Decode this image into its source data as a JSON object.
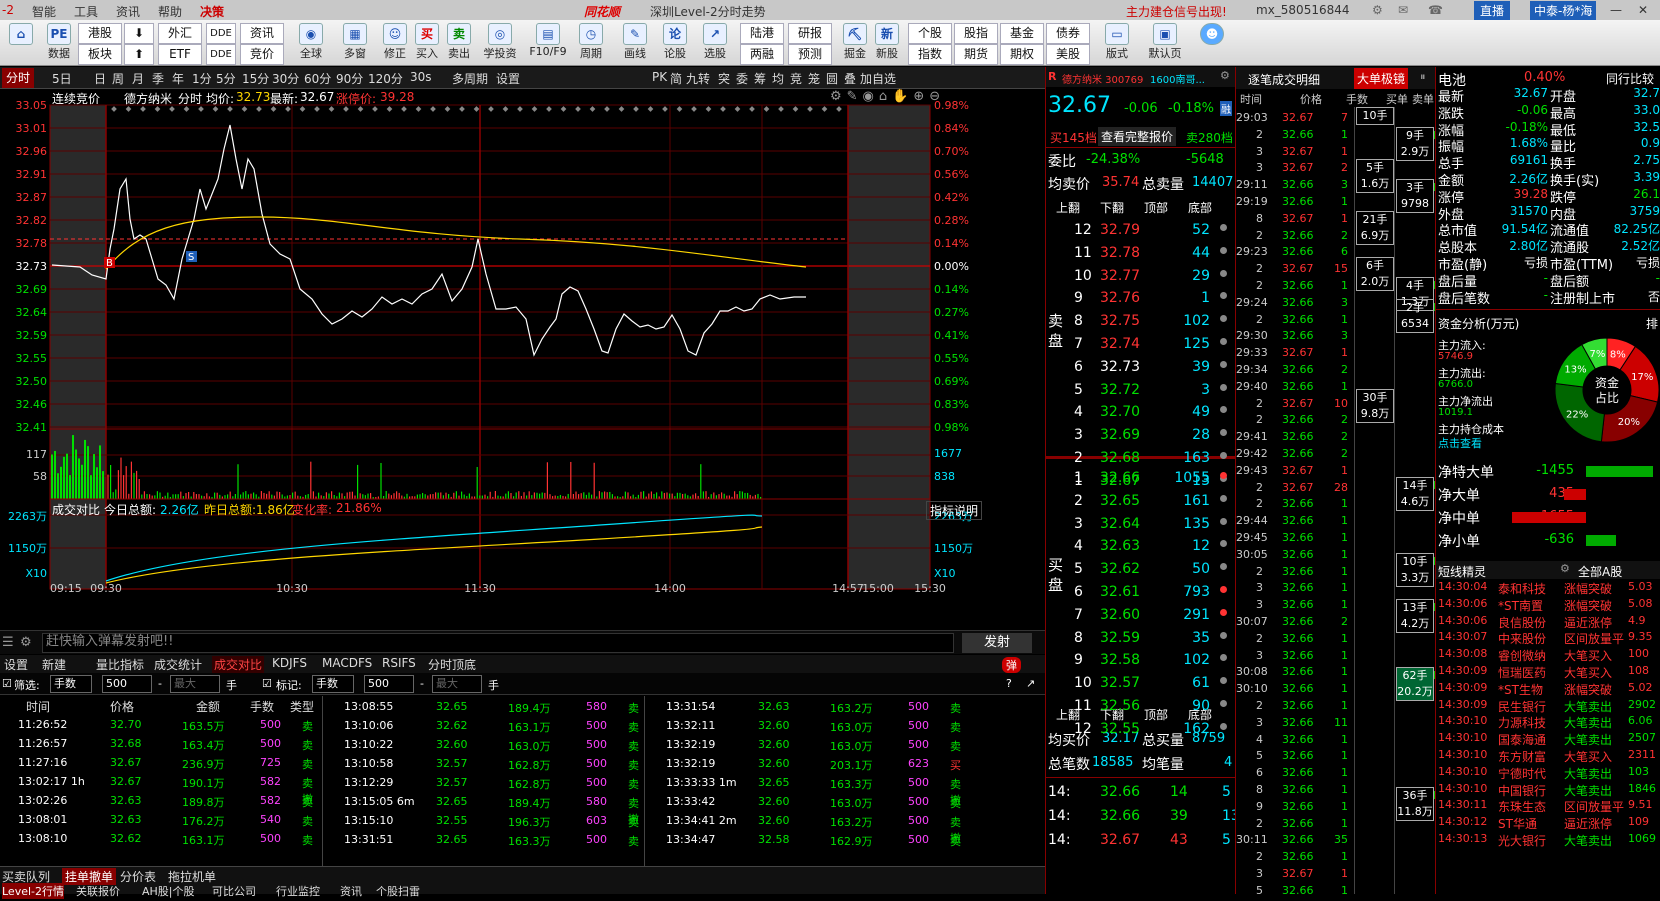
{
  "menu": {
    "left_items": [
      "-2",
      "智能",
      "工具",
      "资讯",
      "帮助",
      "决策"
    ],
    "brand": "同花顺",
    "title": "深圳Level-2分时走势",
    "alert": "主力建仓信号出现!",
    "user": "mx_580516844",
    "live": "直播",
    "broker": "中泰-杨*海"
  },
  "toolbar": {
    "big": [
      {
        "label": "数据",
        "icon": "PE"
      },
      {
        "label": "全球",
        "icon": "◉"
      },
      {
        "label": "多窗",
        "icon": "▦"
      },
      {
        "label": "修正",
        "icon": "☺"
      },
      {
        "label": "买入",
        "icon": "买"
      },
      {
        "label": "卖出",
        "icon": "卖"
      },
      {
        "label": "学投资",
        "icon": "◎"
      },
      {
        "label": "F10/F9",
        "icon": "▤"
      },
      {
        "label": "周期",
        "icon": "◷"
      },
      {
        "label": "画线",
        "icon": "✎"
      },
      {
        "label": "论股",
        "icon": "论"
      },
      {
        "label": "选股",
        "icon": "↗"
      },
      {
        "label": "掘金",
        "icon": "⛏"
      },
      {
        "label": "新股",
        "icon": "新"
      },
      {
        "label": "版式",
        "icon": "▭"
      },
      {
        "label": "默认页",
        "icon": "▣"
      }
    ],
    "small": [
      [
        "港股",
        "板块"
      ],
      [
        "",
        ""
      ],
      [
        "外汇",
        "ETF"
      ],
      [
        "DDE",
        "DDE"
      ],
      [
        "资讯",
        "竞价"
      ],
      [
        "陆港",
        "两融"
      ],
      [
        "研报",
        "预测"
      ],
      [
        "个股",
        "指数"
      ],
      [
        "股指",
        "期货"
      ],
      [
        "基金",
        "期权"
      ],
      [
        "债券",
        "美股"
      ]
    ]
  },
  "period_tabs": [
    "分时",
    "5日",
    "日",
    "周",
    "月",
    "季",
    "年",
    "1分",
    "5分",
    "15分",
    "30分",
    "60分",
    "90分",
    "120分",
    "30s",
    "多周期",
    "设置"
  ],
  "right_tabs": [
    "PK",
    "简",
    "九转",
    "突",
    "委",
    "筹",
    "均",
    "竞",
    "笼",
    "圆",
    "叠",
    "加自选"
  ],
  "chart_header": {
    "label": "连续竞价",
    "name": "德方纳米",
    "mode": "分时",
    "avg_label": "均价:",
    "avg": "32.73",
    "last_label": "最新:",
    "last": "32.67",
    "limit_label": "涨停价:",
    "limit": "39.28"
  },
  "price_axis": [
    "33.05",
    "33.01",
    "32.96",
    "32.91",
    "32.87",
    "32.82",
    "32.78",
    "32.73",
    "32.69",
    "32.64",
    "32.59",
    "32.55",
    "32.50",
    "32.46",
    "32.41"
  ],
  "pct_axis": [
    "0.98%",
    "0.84%",
    "0.70%",
    "0.56%",
    "0.42%",
    "0.28%",
    "0.14%",
    "0.00%",
    "0.14%",
    "0.27%",
    "0.41%",
    "0.55%",
    "0.69%",
    "0.83%",
    "0.98%"
  ],
  "vol_axis": [
    "117",
    "58"
  ],
  "vol_axis_r": [
    "1677",
    "838"
  ],
  "vol_compare": {
    "label": "成交对比",
    "today": "今日总额:",
    "today_v": "2.26亿",
    "yest": "昨日总额:",
    "yest_v": "1.86亿",
    "chg": "变化率:",
    "chg_v": "21.86%",
    "explain": "指标说明",
    "top": "2263万",
    "mid": "1150万",
    "bot": "X10"
  },
  "time_axis": [
    "09:15",
    "09:30",
    "10:30",
    "11:30",
    "14:00",
    "14:57",
    "15:00",
    "15:30"
  ],
  "chat": {
    "placeholder": "赶快输入弹幕发射吧!!",
    "send": "发射",
    "toggle": "弹"
  },
  "sub_tabs": [
    "设置",
    "新建",
    "量比指标",
    "成交统计",
    "成交对比",
    "KDJFS",
    "MACDFS",
    "RSIFS",
    "分时顶底"
  ],
  "filter": {
    "screen": "筛选:",
    "unit": "手数",
    "min": "500",
    "max": "最大",
    "hand": "手",
    "mark": "标记:",
    "unit2": "手数",
    "min2": "500",
    "max2": "最大",
    "hand2": "手"
  },
  "trade_header": [
    "时间",
    "价格",
    "金额",
    "手数",
    "类型"
  ],
  "trades": [
    [
      [
        "11:26:52",
        "32.70",
        "163.5万",
        "500",
        "卖"
      ],
      [
        "11:26:57",
        "32.68",
        "163.4万",
        "500",
        "卖"
      ],
      [
        "11:27:16",
        "32.67",
        "236.9万",
        "725",
        "卖"
      ],
      [
        "13:02:17 1h",
        "32.67",
        "190.1万",
        "582",
        "卖撤"
      ],
      [
        "13:02:26",
        "32.63",
        "189.8万",
        "582",
        "卖"
      ],
      [
        "13:08:01",
        "32.63",
        "176.2万",
        "540",
        "卖"
      ],
      [
        "13:08:10",
        "32.62",
        "163.1万",
        "500",
        "卖"
      ]
    ],
    [
      [
        "13:08:55",
        "32.65",
        "189.4万",
        "580",
        "卖"
      ],
      [
        "13:10:06",
        "32.62",
        "163.1万",
        "500",
        "卖"
      ],
      [
        "13:10:22",
        "32.60",
        "163.0万",
        "500",
        "卖"
      ],
      [
        "13:10:58",
        "32.57",
        "162.8万",
        "500",
        "卖"
      ],
      [
        "13:12:29",
        "32.57",
        "162.8万",
        "500",
        "卖"
      ],
      [
        "13:15:05 6m",
        "32.65",
        "189.4万",
        "580",
        "卖撤"
      ],
      [
        "13:15:10",
        "32.55",
        "196.3万",
        "603",
        "卖"
      ],
      [
        "13:31:51",
        "32.65",
        "163.3万",
        "500",
        "卖"
      ]
    ],
    [
      [
        "13:31:54",
        "32.63",
        "163.2万",
        "500",
        "卖"
      ],
      [
        "13:32:11",
        "32.60",
        "163.0万",
        "500",
        "卖"
      ],
      [
        "13:32:19",
        "32.60",
        "163.0万",
        "500",
        "卖"
      ],
      [
        "13:32:19",
        "32.60",
        "203.1万",
        "623",
        "买"
      ],
      [
        "13:33:33 1m",
        "32.65",
        "163.3万",
        "500",
        "卖撤"
      ],
      [
        "13:33:42",
        "32.60",
        "163.0万",
        "500",
        "卖"
      ],
      [
        "13:34:41 2m",
        "32.60",
        "163.2万",
        "500",
        "卖撤"
      ],
      [
        "13:34:47",
        "32.58",
        "162.9万",
        "500",
        "卖"
      ]
    ]
  ],
  "bottom_tabs": [
    "买卖队列",
    "挂单撤单",
    "分价表",
    "拖拉机单"
  ],
  "bottom_tabs2": [
    "Level-2行情",
    "关联报价",
    "AH股|个股",
    "可比公司",
    "行业监控",
    "资讯",
    "个股扫雷"
  ],
  "quote": {
    "code_label": "德方纳米 300769",
    "sub": "1600南哥...",
    "price": "32.67",
    "chg": "-0.06",
    "pct": "-0.18%",
    "tag": "融",
    "buy_levels": "买145档",
    "view_all": "查看完整报价",
    "sell_levels": "卖280档",
    "wb_label": "委比",
    "wb": "-24.38%",
    "wc": "-5648",
    "avg_sell_label": "均卖价",
    "avg_sell": "35.74",
    "total_sell_label": "总卖量",
    "total_sell": "14407",
    "avg_buy_label": "均买价",
    "avg_buy": "32.17",
    "total_buy_label": "总买量",
    "total_buy": "8759",
    "orders_label": "总笔数",
    "orders": "18585",
    "avg_vol_label": "均笔量",
    "avg_vol": "4"
  },
  "nav": [
    "上翻",
    "下翻",
    "顶部",
    "底部"
  ],
  "sell_book": [
    [
      "12",
      "32.79",
      "52"
    ],
    [
      "11",
      "32.78",
      "44"
    ],
    [
      "10",
      "32.77",
      "29"
    ],
    [
      "9",
      "32.76",
      "1"
    ],
    [
      "8",
      "32.75",
      "102"
    ],
    [
      "7",
      "32.74",
      "125"
    ],
    [
      "6",
      "32.73",
      "39"
    ],
    [
      "5",
      "32.72",
      "3"
    ],
    [
      "4",
      "32.70",
      "49"
    ],
    [
      "3",
      "32.69",
      "28"
    ],
    [
      "2",
      "32.68",
      "163"
    ],
    [
      "1",
      "32.67",
      "13"
    ]
  ],
  "buy_book": [
    [
      "1",
      "32.66",
      "1055"
    ],
    [
      "2",
      "32.65",
      "161"
    ],
    [
      "3",
      "32.64",
      "135"
    ],
    [
      "4",
      "32.63",
      "12"
    ],
    [
      "5",
      "32.62",
      "50"
    ],
    [
      "6",
      "32.61",
      "793"
    ],
    [
      "7",
      "32.60",
      "291"
    ],
    [
      "8",
      "32.59",
      "35"
    ],
    [
      "9",
      "32.58",
      "102"
    ],
    [
      "10",
      "32.57",
      "61"
    ],
    [
      "11",
      "32.56",
      "90"
    ],
    [
      "12",
      "32.55",
      "162"
    ]
  ],
  "sell_label": "卖盘",
  "buy_label": "买盘",
  "tick_rows": [
    [
      "14:",
      "32.66",
      "14"
    ],
    [
      "14:",
      "32.66",
      "39"
    ],
    [
      "14:",
      "32.67",
      "43"
    ]
  ],
  "tick_rows_r": [
    "5",
    "13",
    "5"
  ],
  "detail": {
    "title": "逐笔成交明细",
    "title2": "大单极镜",
    "cols": [
      "时间",
      "价格",
      "手数",
      "买单",
      "卖单"
    ]
  },
  "detail_rows": [
    [
      "29:03",
      "32.67",
      "7"
    ],
    [
      "2",
      "32.66",
      "1"
    ],
    [
      "3",
      "32.67",
      "1"
    ],
    [
      "3",
      "32.67",
      "2"
    ],
    [
      "29:11",
      "32.66",
      "3"
    ],
    [
      "29:19",
      "32.66",
      "1"
    ],
    [
      "8",
      "32.67",
      "1"
    ],
    [
      "2",
      "32.66",
      "2"
    ],
    [
      "29:23",
      "32.66",
      "6"
    ],
    [
      "2",
      "32.67",
      "15"
    ],
    [
      "2",
      "32.66",
      "1"
    ],
    [
      "29:24",
      "32.66",
      "3"
    ],
    [
      "2",
      "32.66",
      "1"
    ],
    [
      "29:30",
      "32.66",
      "3"
    ],
    [
      "29:33",
      "32.67",
      "1"
    ],
    [
      "29:34",
      "32.66",
      "2"
    ],
    [
      "29:40",
      "32.66",
      "1"
    ],
    [
      "2",
      "32.67",
      "10"
    ],
    [
      "2",
      "32.66",
      "2"
    ],
    [
      "29:41",
      "32.66",
      "2"
    ],
    [
      "29:42",
      "32.66",
      "2"
    ],
    [
      "29:43",
      "32.67",
      "1"
    ],
    [
      "2",
      "32.67",
      "28"
    ],
    [
      "2",
      "32.66",
      "1"
    ],
    [
      "29:44",
      "32.66",
      "1"
    ],
    [
      "29:45",
      "32.66",
      "1"
    ],
    [
      "30:05",
      "32.66",
      "1"
    ],
    [
      "2",
      "32.66",
      "1"
    ],
    [
      "3",
      "32.66",
      "1"
    ],
    [
      "3",
      "32.66",
      "1"
    ],
    [
      "30:07",
      "32.66",
      "2"
    ],
    [
      "2",
      "32.66",
      "1"
    ],
    [
      "3",
      "32.66",
      "1"
    ],
    [
      "30:08",
      "32.66",
      "1"
    ],
    [
      "30:10",
      "32.66",
      "1"
    ],
    [
      "2",
      "32.66",
      "1"
    ],
    [
      "3",
      "32.66",
      "11"
    ],
    [
      "4",
      "32.66",
      "1"
    ],
    [
      "5",
      "32.66",
      "1"
    ],
    [
      "6",
      "32.66",
      "1"
    ],
    [
      "8",
      "32.66",
      "1"
    ],
    [
      "9",
      "32.66",
      "1"
    ],
    [
      "2",
      "32.66",
      "1"
    ],
    [
      "30:11",
      "32.66",
      "35"
    ],
    [
      "2",
      "32.66",
      "1"
    ],
    [
      "3",
      "32.67",
      "1"
    ],
    [
      "5",
      "32.66",
      "1"
    ]
  ],
  "big_buy": [
    [
      "10手",
      ""
    ],
    [
      "9手",
      "2.9万"
    ],
    [
      "5手",
      "1.6万"
    ],
    [
      "3手",
      "9798"
    ],
    [
      "21手",
      "6.9万"
    ],
    [
      "6手",
      "2.0万"
    ],
    [
      "4手",
      "1.3万"
    ],
    [
      "2手",
      "6534"
    ],
    [
      "30手",
      "9.8万"
    ],
    [
      "14手",
      "4.6万"
    ],
    [
      "10手",
      "3.3万"
    ],
    [
      "13手",
      "4.2万"
    ],
    [
      "62手",
      "20.2万"
    ],
    [
      "36手",
      "11.8万"
    ]
  ],
  "stats": {
    "name": "电池",
    "pct": "0.40%",
    "peer": "同行比较",
    "rows": [
      [
        "最新",
        "32.67",
        "开盘",
        "32.7"
      ],
      [
        "涨跌",
        "-0.06",
        "最高",
        "33.0"
      ],
      [
        "涨幅",
        "-0.18%",
        "最低",
        "32.5"
      ],
      [
        "振幅",
        "1.68%",
        "量比",
        "0.9"
      ],
      [
        "总手",
        "69161",
        "换手",
        "2.75"
      ],
      [
        "金额",
        "2.26亿",
        "换手(实)",
        "3.39"
      ],
      [
        "涨停",
        "39.28",
        "跌停",
        "26.1"
      ],
      [
        "外盘",
        "31570",
        "内盘",
        "3759"
      ],
      [
        "总市值",
        "91.54亿",
        "流通值",
        "82.25亿"
      ],
      [
        "总股本",
        "2.80亿",
        "流通股",
        "2.52亿"
      ],
      [
        "市盈(静)",
        "亏损",
        "市盈(TTM)",
        "亏损"
      ],
      [
        "盘后量",
        "-",
        "盘后额",
        "-"
      ],
      [
        "盘后笔数",
        "-",
        "注册制上市",
        "否"
      ]
    ]
  },
  "fund": {
    "title": "资金分析(万元)",
    "sort": "排",
    "in_label": "主力流入:",
    "in": "5746.9",
    "out_label": "主力流出:",
    "out": "6766.0",
    "net_label": "主力净流出",
    "net": "1019.1",
    "cost_label": "主力持仓成本",
    "cost": "点击查看",
    "center": "资金",
    "center2": "占比",
    "pie": [
      {
        "pct": "8%",
        "color": "#ff2222",
        "v": 8
      },
      {
        "pct": "17%",
        "color": "#cc0000",
        "v": 17
      },
      {
        "pct": "20%",
        "color": "#880000",
        "v": 20
      },
      {
        "pct": "22%",
        "color": "#006600",
        "v": 22
      },
      {
        "pct": "13%",
        "color": "#00aa00",
        "v": 13
      },
      {
        "pct": "7%",
        "color": "#33dd33",
        "v": 7
      }
    ]
  },
  "flows": [
    {
      "label": "净特大单",
      "v": "-1455",
      "dir": "grn",
      "w": 0.9
    },
    {
      "label": "净大单",
      "v": "435",
      "dir": "red",
      "w": 0.3
    },
    {
      "label": "净中单",
      "v": "1655",
      "dir": "red",
      "w": 1
    },
    {
      "label": "净小单",
      "v": "-636",
      "dir": "grn",
      "w": 0.4
    }
  ],
  "sprite": {
    "title": "短线精灵",
    "scope": "全部A股",
    "rows": [
      [
        "14:30:04",
        "泰和科技",
        "涨幅突破",
        "5.03"
      ],
      [
        "14:30:06",
        "*ST南置",
        "涨幅突破",
        "5.08"
      ],
      [
        "14:30:06",
        "良信股份",
        "逼近涨停",
        "4.9"
      ],
      [
        "14:30:07",
        "中来股份",
        "区间放量平",
        "9.35"
      ],
      [
        "14:30:08",
        "睿创微纳",
        "大笔买入",
        "100"
      ],
      [
        "14:30:09",
        "恒瑞医药",
        "大笔买入",
        "108"
      ],
      [
        "14:30:09",
        "*ST生物",
        "涨幅突破",
        "5.02"
      ],
      [
        "14:30:09",
        "民生银行",
        "大笔卖出",
        "2902"
      ],
      [
        "14:30:10",
        "力源科技",
        "大笔卖出",
        "6.06"
      ],
      [
        "14:30:10",
        "国泰海通",
        "大笔卖出",
        "2507"
      ],
      [
        "14:30:10",
        "东方财富",
        "大笔买入",
        "2311"
      ],
      [
        "14:30:10",
        "宁德时代",
        "大笔卖出",
        "103"
      ],
      [
        "14:30:10",
        "中国银行",
        "大笔卖出",
        "1846"
      ],
      [
        "14:30:11",
        "东珠生态",
        "区间放量平",
        "9.51"
      ],
      [
        "14:30:12",
        "ST华通",
        "逼近涨停",
        "109"
      ],
      [
        "14:30:13",
        "光大银行",
        "大笔卖出",
        "1069"
      ]
    ]
  }
}
